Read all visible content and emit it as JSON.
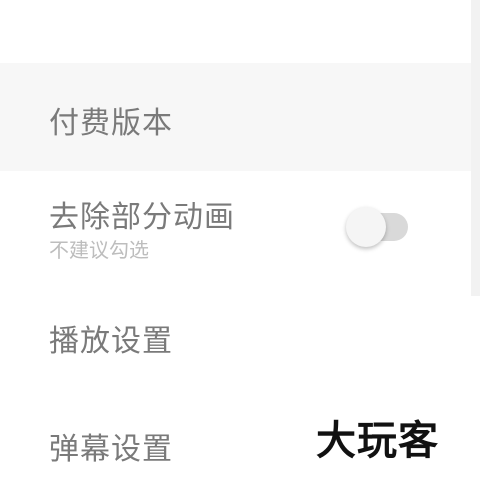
{
  "settings": {
    "paid_version": {
      "title": "付费版本"
    },
    "remove_animation": {
      "title": "去除部分动画",
      "subtitle": "不建议勾选",
      "enabled": false
    },
    "playback_settings": {
      "title": "播放设置"
    },
    "danmaku_settings": {
      "title": "弹幕设置"
    }
  },
  "watermark": {
    "text": "大玩客"
  },
  "colors": {
    "title_text": "#7a7a7a",
    "subtitle_text": "#bdbdbd",
    "highlight_row": "#f7f7f7",
    "toggle_track_off": "#d9d9d9",
    "toggle_knob": "#f5f5f5"
  }
}
